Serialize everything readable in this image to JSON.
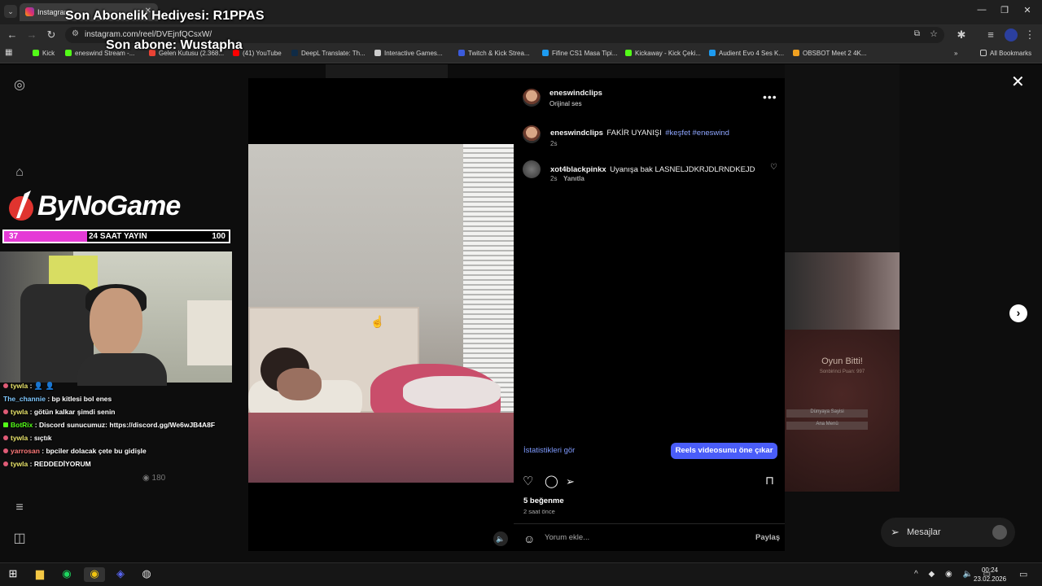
{
  "browser": {
    "tab_title": "Instagram",
    "url": "instagram.com/reel/DVEjnfQCsxW/",
    "bookmarks": [
      {
        "label": "Kick",
        "color": "#53fc18"
      },
      {
        "label": "eneswind Stream -...",
        "color": "#53fc18"
      },
      {
        "label": "Gelen Kutusu (2.368...",
        "color": "#ea4335"
      },
      {
        "label": "(41) YouTube",
        "color": "#ff0000"
      },
      {
        "label": "DeepL Translate: Th...",
        "color": "#0f2b46"
      },
      {
        "label": "Interactive Games...",
        "color": "#cccccc"
      },
      {
        "label": "Twitch & Kick Strea...",
        "color": "#3b5bdb"
      },
      {
        "label": "Fifine CS1 Masa Tipi...",
        "color": "#1d9bf0"
      },
      {
        "label": "Kickaway - Kick Çeki...",
        "color": "#53fc18"
      },
      {
        "label": "Audient Evo 4 Ses K...",
        "color": "#1d9bf0"
      },
      {
        "label": "OBSBOT Meet 2 4K...",
        "color": "#f0a020"
      }
    ],
    "all_bookmarks": "All Bookmarks"
  },
  "overlay": {
    "gift_text": "Son Abonelik Hediyesi: R1PPAS",
    "sub_text": "Son abone: Wustapha",
    "brand": "ByNoGame",
    "progress_left": "37",
    "progress_mid": "24 SAAT YAYIN",
    "progress_right": "100",
    "progress_fraction": 0.37,
    "views": "180"
  },
  "chat": [
    {
      "user": "tywla",
      "text": "",
      "color": "#e8e36a"
    },
    {
      "user": "The_channie",
      "text": "bp kitlesi bol enes",
      "color": "#7fc8ff"
    },
    {
      "user": "tywla",
      "text": "götün kalkar şimdi senin",
      "color": "#e8e36a"
    },
    {
      "user": "BotRix",
      "text": "Discord sunucumuz: https://discord.gg/We6wJB4A8F",
      "color": "#53fc18"
    },
    {
      "user": "tywla",
      "text": "sıçtık",
      "color": "#e8e36a"
    },
    {
      "user": "yarrosan",
      "text": "bpciler dolacak çete bu gidişle",
      "color": "#ff7a7a"
    },
    {
      "user": "tywla",
      "text": "REDDEDİYORUM",
      "color": "#e8e36a"
    }
  ],
  "post": {
    "author": "eneswindclips",
    "audio": "Orijinal ses",
    "caption_user": "eneswindclips",
    "caption_text": "FAKİR UYANIŞI",
    "caption_tags": "#keşfet #eneswind",
    "caption_time": "2s",
    "comment_user": "xot4blackpinkx",
    "comment_text": "Uyanışa bak LASNELJDKRJDLRNDKEJD",
    "comment_time": "2s",
    "comment_reply": "Yanıtla",
    "stats_link": "İstatistikleri gör",
    "boost_button": "Reels videosunu öne çıkar",
    "likes": "5 beğenme",
    "posted": "2 saat önce",
    "comment_placeholder": "Yorum ekle...",
    "share": "Paylaş"
  },
  "messages": "Mesajlar",
  "game": {
    "title": "Oyun Bitti!",
    "line": "Sonbirinci Puan: 997",
    "btn1": "Dünyaya Sayisi",
    "btn2": "Ana Menü"
  },
  "taskbar": {
    "time": "00:24",
    "date": "23.02.2026"
  }
}
